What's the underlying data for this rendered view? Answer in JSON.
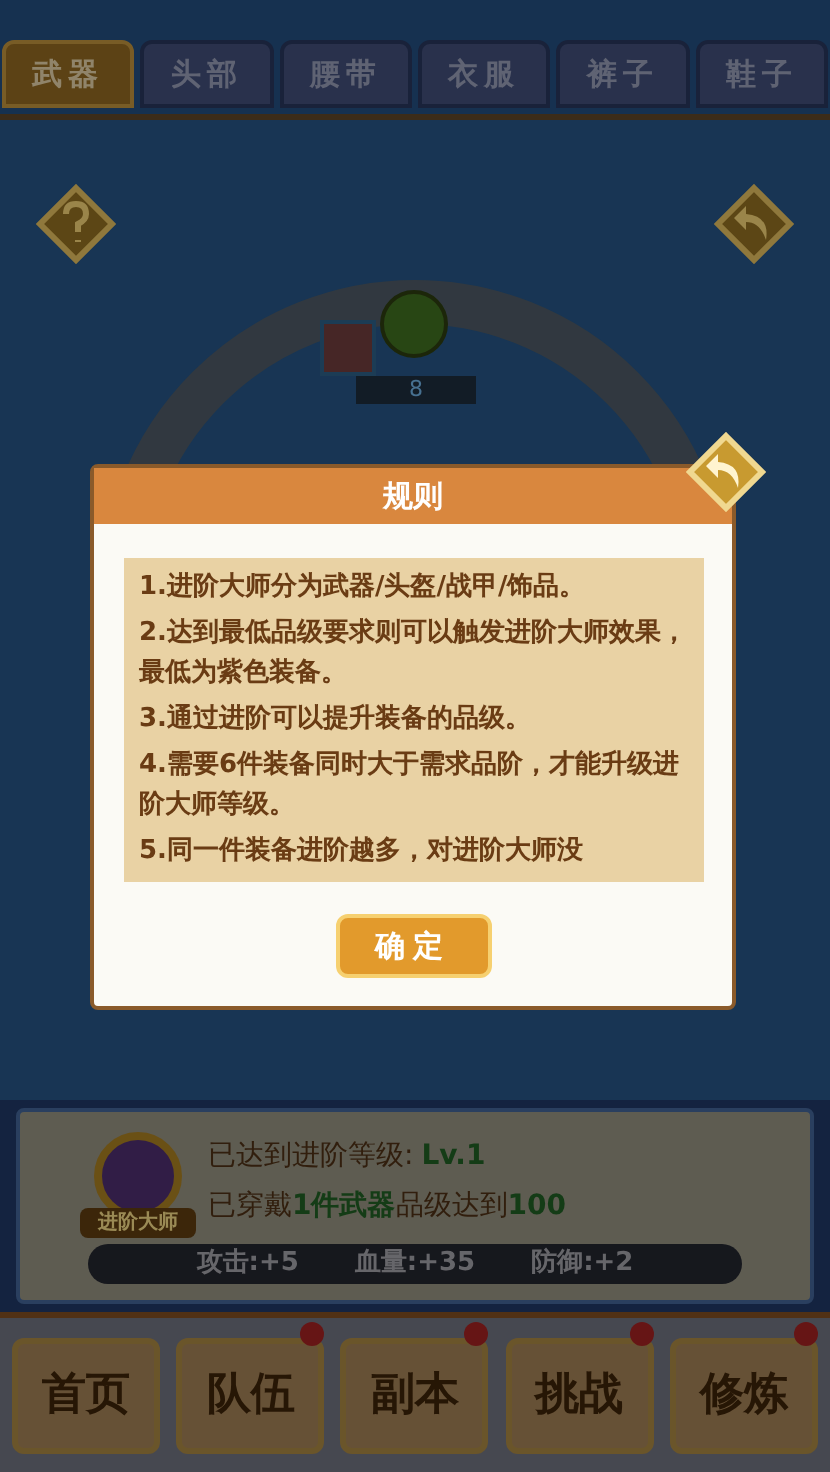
{
  "tabs": [
    {
      "label": "武器",
      "selected": true
    },
    {
      "label": "头部",
      "selected": false
    },
    {
      "label": "腰带",
      "selected": false
    },
    {
      "label": "衣服",
      "selected": false
    },
    {
      "label": "裤子",
      "selected": false
    },
    {
      "label": "鞋子",
      "selected": false
    }
  ],
  "ring": {
    "count": "8"
  },
  "dialog": {
    "title": "规则",
    "rules": [
      "1.进阶大师分为武器/头盔/战甲/饰品。",
      "2.达到最低品级要求则可以触发进阶大师效果，最低为紫色装备。",
      "3.通过进阶可以提升装备的品级。",
      "4.需要6件装备同时大于需求品阶，才能升级进阶大师等级。",
      "5.同一件装备进阶越多，对进阶大师没"
    ],
    "confirm": "确定"
  },
  "master": {
    "badge": "进阶大师",
    "level_label": "已达到进阶等级:",
    "level_value": "Lv.1",
    "requirement": [
      {
        "text": "已穿戴",
        "highlight": false
      },
      {
        "text": "1件武器",
        "highlight": true
      },
      {
        "text": "品级达到",
        "highlight": false
      },
      {
        "text": "100",
        "highlight": true
      }
    ],
    "stats": [
      "攻击:+5",
      "血量:+35",
      "防御:+2"
    ]
  },
  "nav": [
    {
      "label": "首页",
      "badge": false
    },
    {
      "label": "队伍",
      "badge": true
    },
    {
      "label": "副本",
      "badge": true
    },
    {
      "label": "挑战",
      "badge": true
    },
    {
      "label": "修炼",
      "badge": true
    }
  ]
}
